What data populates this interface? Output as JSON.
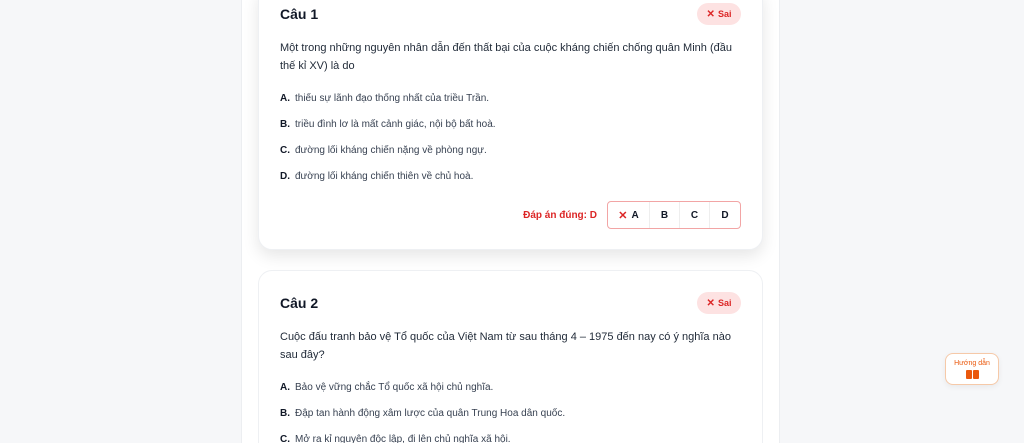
{
  "questions": [
    {
      "title": "Câu 1",
      "status": "Sai",
      "text": "Một trong những nguyên nhân dẫn đến thất bại của cuộc kháng chiến chống quân Minh (đầu thế kỉ XV) là do",
      "options": [
        {
          "key": "A.",
          "text": "thiếu sự lãnh đạo thống nhất của triều Trần."
        },
        {
          "key": "B.",
          "text": "triều đình lơ là mất cảnh giác, nội bộ bất hoà."
        },
        {
          "key": "C.",
          "text": "đường lối kháng chiến nặng về phòng ngự."
        },
        {
          "key": "D.",
          "text": "đường lối kháng chiến thiên về chủ hoà."
        }
      ],
      "correct_label": "Đáp án đúng: D",
      "choices": [
        "A",
        "B",
        "C",
        "D"
      ]
    },
    {
      "title": "Câu 2",
      "status": "Sai",
      "text": "Cuộc đấu tranh bảo vệ Tổ quốc của Việt Nam từ sau tháng 4 – 1975 đến nay có ý nghĩa nào sau đây?",
      "options": [
        {
          "key": "A.",
          "text": "Bảo vệ vững chắc Tổ quốc xã hội chủ nghĩa."
        },
        {
          "key": "B.",
          "text": "Đập tan hành động xâm lược của quân Trung Hoa dân quốc."
        },
        {
          "key": "C.",
          "text": "Mở ra kỉ nguyên độc lập, đi lên chủ nghĩa xã hội."
        }
      ]
    }
  ],
  "guide": {
    "label": "Hướng dẫn",
    "icon": "book-icon"
  },
  "colors": {
    "wrong": "#dc2626",
    "guide": "#ea580c"
  }
}
